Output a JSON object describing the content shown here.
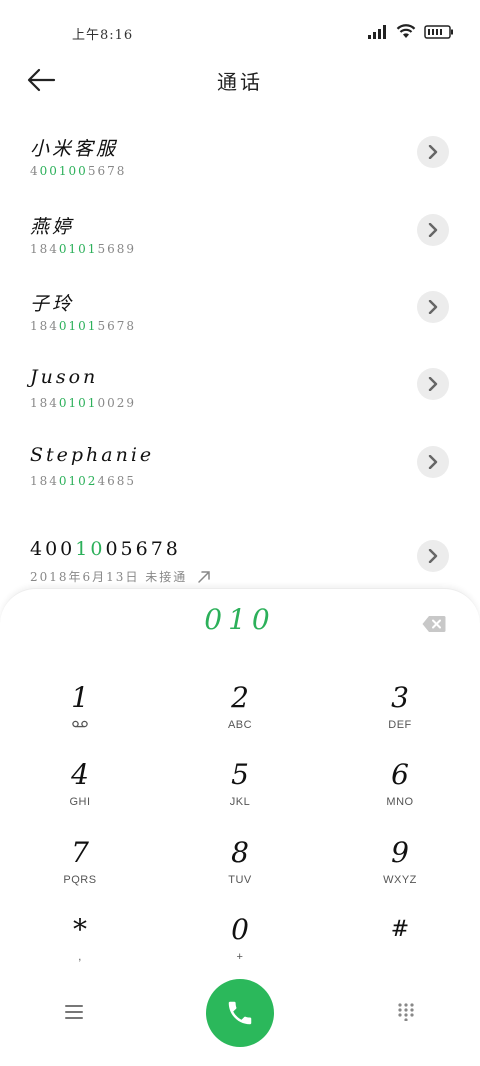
{
  "status_bar": {
    "time": "上午8:16"
  },
  "header": {
    "title": "通话"
  },
  "contacts": [
    {
      "name": "小米客服",
      "number_pre": "4",
      "number_hl": "00100",
      "number_post": "5678"
    },
    {
      "name": "燕婷",
      "number_pre": "184",
      "number_hl": "0101",
      "number_post": "5689"
    },
    {
      "name": "子玲",
      "number_pre": "184",
      "number_hl": "0101",
      "number_post": "5678"
    },
    {
      "name": "Juson",
      "number_pre": "184",
      "number_hl": "0101",
      "number_post": "0029"
    },
    {
      "name": "Stephanie",
      "number_pre": "184",
      "number_hl": "0102",
      "number_post": "4685"
    }
  ],
  "recent": {
    "number_pre": "400",
    "number_hl": "10",
    "number_post": "05678",
    "detail": "2018年6月13日 未接通"
  },
  "dialpad": {
    "display": "010",
    "keys": [
      {
        "digit": "1",
        "letters": ""
      },
      {
        "digit": "2",
        "letters": "ABC"
      },
      {
        "digit": "3",
        "letters": "DEF"
      },
      {
        "digit": "4",
        "letters": "GHI"
      },
      {
        "digit": "5",
        "letters": "JKL"
      },
      {
        "digit": "6",
        "letters": "MNO"
      },
      {
        "digit": "7",
        "letters": "PQRS"
      },
      {
        "digit": "8",
        "letters": "TUV"
      },
      {
        "digit": "9",
        "letters": "WXYZ"
      },
      {
        "digit": "*",
        "letters": ","
      },
      {
        "digit": "0",
        "letters": "+"
      },
      {
        "digit": "#",
        "letters": ""
      }
    ]
  },
  "colors": {
    "accent": "#2cb05a",
    "call": "#2bb85b"
  },
  "icons": [
    "back-arrow-icon",
    "chevron-right-icon",
    "outgoing-call-icon",
    "backspace-icon",
    "voicemail-icon",
    "menu-icon",
    "phone-icon",
    "dialpad-icon",
    "signal-icon",
    "wifi-icon",
    "battery-icon"
  ]
}
